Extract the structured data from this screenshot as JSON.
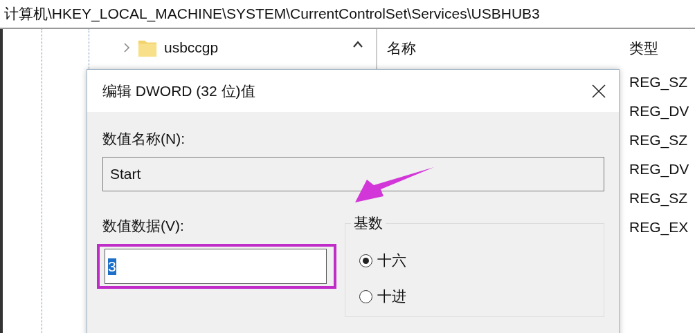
{
  "address_bar": "计算机\\HKEY_LOCAL_MACHINE\\SYSTEM\\CurrentControlSet\\Services\\USBHUB3",
  "tree": {
    "items": [
      {
        "label": "usbccgp",
        "expanded": false
      }
    ]
  },
  "list": {
    "columns": [
      "名称",
      "类型"
    ],
    "rows": [
      {
        "type": "REG_SZ"
      },
      {
        "type": "REG_DV"
      },
      {
        "type": "REG_SZ"
      },
      {
        "type": "REG_DV"
      },
      {
        "type": "REG_SZ"
      },
      {
        "type": "REG_EX"
      }
    ]
  },
  "dialog": {
    "title": "编辑 DWORD (32 位)值",
    "name_label": "数值名称(N):",
    "name_value": "Start",
    "data_label": "数值数据(V):",
    "data_value": "3",
    "base": {
      "label": "基数",
      "options": [
        {
          "label": "十六",
          "selected": true
        },
        {
          "label": "十进",
          "selected": false
        }
      ]
    }
  }
}
